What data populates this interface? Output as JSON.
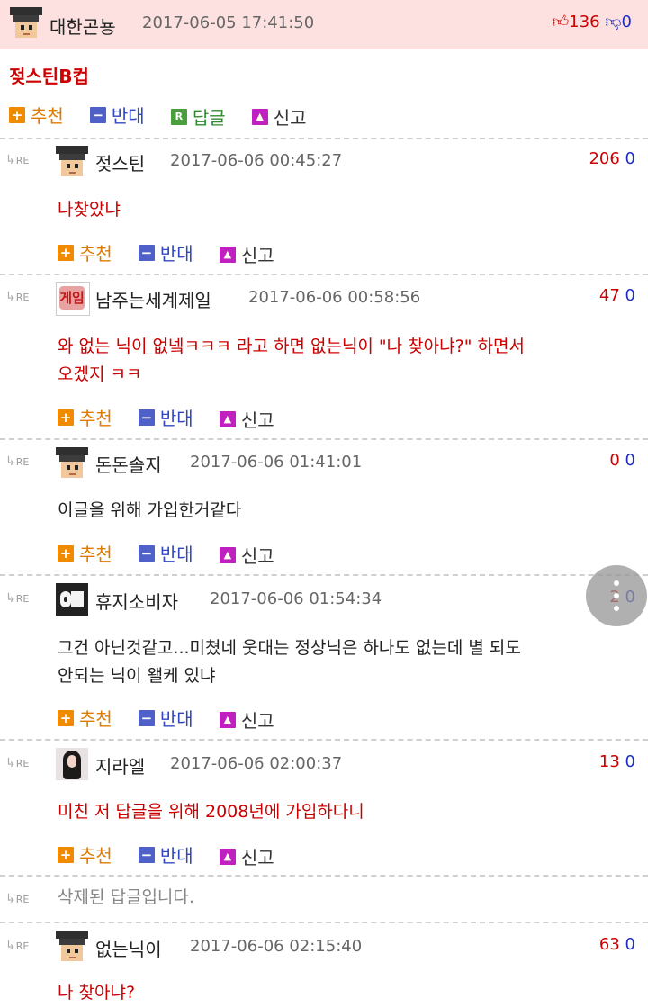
{
  "post": {
    "author": "대한곤뇽",
    "datetime": "2017-06-05 17:41:50",
    "upvotes": "136",
    "downvotes": "0",
    "title": "젖스틴B컵",
    "actions": {
      "recommend": "추천",
      "oppose": "반대",
      "reply": "답글",
      "report": "신고"
    },
    "action_icons": {
      "recommend": "+",
      "oppose": "−",
      "reply": "R",
      "report": "▲"
    }
  },
  "re_label": "RE",
  "comments": [
    {
      "author": "젖스틴",
      "datetime": "2017-06-06 00:45:27",
      "up": "206",
      "down": "0",
      "lines": [
        "나찾았냐"
      ],
      "color": "red",
      "avatar": "default-icon"
    },
    {
      "author": "남주는세계제일",
      "datetime": "2017-06-06 00:58:56",
      "up": "47",
      "down": "0",
      "lines": [
        "와 없는 닉이 없넼ㅋㅋㅋ 라고 하면 없는닉이 \"나 찾아냐?\" 하면서",
        "오겠지 ㅋㅋ"
      ],
      "color": "red",
      "avatar": "game-icon",
      "avatar_text": "게임"
    },
    {
      "author": "돈돈솔지",
      "datetime": "2017-06-06 01:41:01",
      "up": "0",
      "down": "0",
      "lines": [
        "이글을 위해 가입한거같다"
      ],
      "color": "black",
      "avatar": "default-icon"
    },
    {
      "author": "휴지소비자",
      "datetime": "2017-06-06 01:54:34",
      "up": "2",
      "down": "0",
      "lines": [
        "그건 아닌것같고...미쳤네 웃대는 정상닉은 하나도 없는데 별 되도",
        "안되는 닉이 왤케 있냐"
      ],
      "color": "black",
      "avatar": "toilet-paper-icon"
    },
    {
      "author": "지라엘",
      "datetime": "2017-06-06 02:00:37",
      "up": "13",
      "down": "0",
      "lines": [
        "미친 저 답글을 위해 2008년에 가입하다니"
      ],
      "color": "red",
      "avatar": "photo-avatar"
    },
    {
      "deleted_text": "삭제된 답글입니다."
    },
    {
      "author": "없는닉이",
      "datetime": "2017-06-06 02:15:40",
      "up": "63",
      "down": "0",
      "lines": [
        "나 찾아냐?"
      ],
      "color": "red",
      "avatar": "default-icon"
    }
  ],
  "colors": {
    "header_bg": "#fde0e0",
    "accent_red": "#cc0000",
    "down_blue": "#1c2ec8",
    "recommend_orange": "#f08a00",
    "oppose_blue": "#4f61c9",
    "reply_green": "#4a9e3e",
    "report_magenta": "#c020c0"
  }
}
